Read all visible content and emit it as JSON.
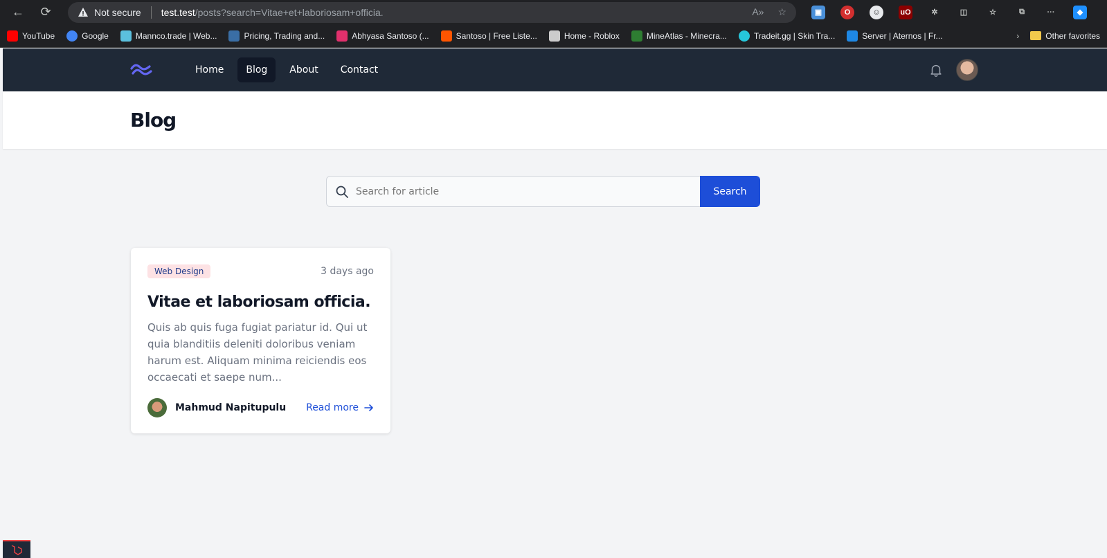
{
  "browser": {
    "security_label": "Not secure",
    "url_host": "test.test",
    "url_path": "/posts?search=Vitae+et+laboriosam+officia.",
    "bookmarks": [
      {
        "label": "YouTube",
        "color": "#ff0000"
      },
      {
        "label": "Google",
        "color": "#4285f4"
      },
      {
        "label": "Mannco.trade | Web...",
        "color": "#5bc0de"
      },
      {
        "label": "Pricing, Trading and...",
        "color": "#3a6ea5"
      },
      {
        "label": "Abhyasa Santoso (...",
        "color": "#e1306c"
      },
      {
        "label": "Santoso | Free Liste...",
        "color": "#ff5500"
      },
      {
        "label": "Home - Roblox",
        "color": "#cccccc"
      },
      {
        "label": "MineAtlas - Minecra...",
        "color": "#2e7d32"
      },
      {
        "label": "Tradeit.gg | Skin Tra...",
        "color": "#26c6da"
      },
      {
        "label": "Server | Aternos | Fr...",
        "color": "#1e88e5"
      }
    ],
    "other_favorites": "Other favorites"
  },
  "nav": {
    "links": [
      "Home",
      "Blog",
      "About",
      "Contact"
    ],
    "active": "Blog"
  },
  "header": {
    "title": "Blog"
  },
  "search": {
    "placeholder": "Search for article",
    "button": "Search"
  },
  "post": {
    "category": "Web Design",
    "date": "3 days ago",
    "title": "Vitae et laboriosam officia.",
    "excerpt": "Quis ab quis fuga fugiat pariatur id. Qui ut quia blanditiis deleniti doloribus veniam harum est. Aliquam minima reiciendis eos occaecati et saepe num...",
    "author": "Mahmud Napitupulu",
    "read_more": "Read more"
  }
}
